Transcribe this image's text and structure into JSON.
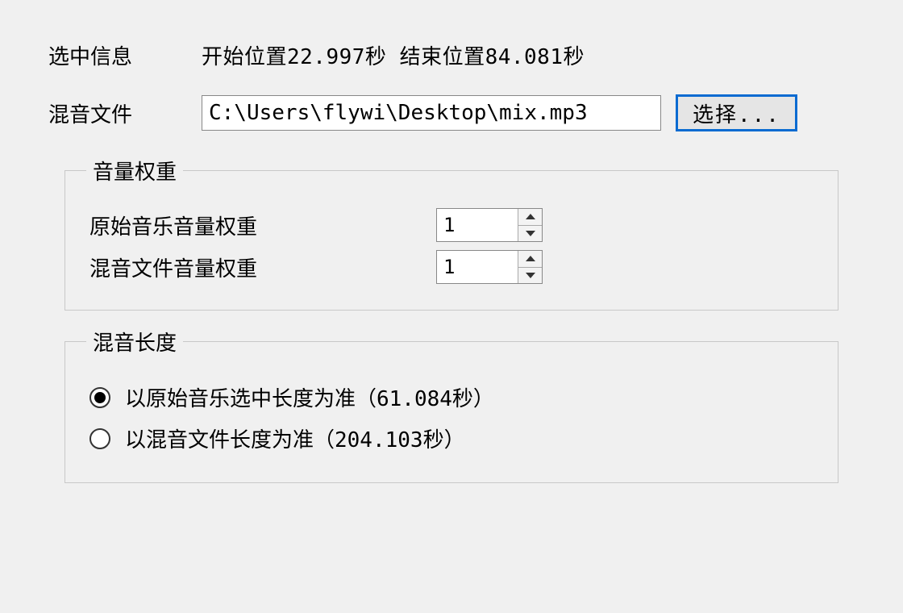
{
  "selection": {
    "label": "选中信息",
    "info": "开始位置22.997秒 结束位置84.081秒"
  },
  "mix_file": {
    "label": "混音文件",
    "path": "C:\\Users\\flywi\\Desktop\\mix.mp3",
    "browse_label": "选择..."
  },
  "volume_weight": {
    "legend": "音量权重",
    "original_label": "原始音乐音量权重",
    "original_value": "1",
    "mix_label": "混音文件音量权重",
    "mix_value": "1"
  },
  "mix_length": {
    "legend": "混音长度",
    "options": [
      {
        "label": "以原始音乐选中长度为准（61.084秒）",
        "checked": true
      },
      {
        "label": "以混音文件长度为准（204.103秒）",
        "checked": false
      }
    ]
  }
}
